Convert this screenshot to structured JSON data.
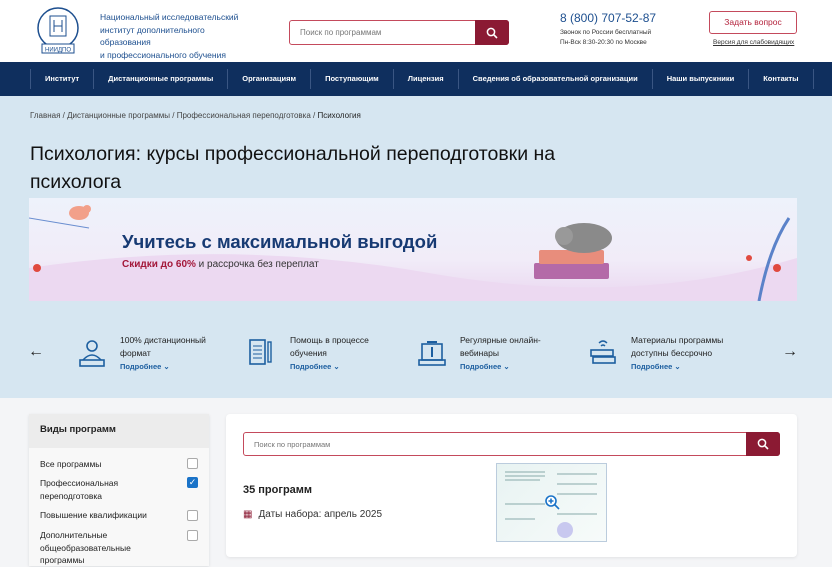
{
  "header": {
    "institute_name": [
      "Национальный исследовательский",
      "институт дополнительного образования",
      "и профессионального обучения"
    ],
    "logo_text": "НИИДПО",
    "search_placeholder": "Поиск по программам",
    "phone": "8 (800) 707-52-87",
    "phone_note": "Звонок по России бесплатный",
    "hours": "Пн-Вск 8:30-20:30 по Москве",
    "ask_button": "Задать вопрос",
    "accessibility_link": "Версия для слабовидящих"
  },
  "nav": [
    "Институт",
    "Дистанционные программы",
    "Организациям",
    "Поступающим",
    "Лицензия",
    "Сведения об образовательной организации",
    "Наши выпускники",
    "Контакты"
  ],
  "breadcrumb": [
    "Главная",
    "Дистанционные программы",
    "Профессиональная переподготовка",
    "Психология"
  ],
  "page_title": "Психология: курсы профессиональной переподготовки на психолога",
  "banner": {
    "headline": "Учитесь с максимальной выгодой",
    "discount": "Скидки до 60%",
    "rest": " и рассрочка без переплат"
  },
  "features": [
    {
      "text": "100% дистанционный формат",
      "more": "Подробнее ⌄"
    },
    {
      "text": "Помощь в процессе обучения",
      "more": "Подробнее ⌄"
    },
    {
      "text": "Регулярные онлайн-вебинары",
      "more": "Подробнее ⌄"
    },
    {
      "text": "Материалы программы доступны бессрочно",
      "more": "Подробнее ⌄"
    }
  ],
  "sidebar": {
    "title": "Виды программ",
    "options": [
      {
        "label": "Все программы",
        "checked": false
      },
      {
        "label": "Профессиональная переподготовка",
        "checked": true
      },
      {
        "label": "Повышение квалификации",
        "checked": false
      },
      {
        "label": "Дополнительные общеобразовательные программы",
        "checked": false
      }
    ]
  },
  "main": {
    "search_placeholder": "Поиск по программам",
    "count": "35 программ",
    "dates": "Даты набора: апрель 2025"
  },
  "colors": {
    "primary": "#0f2f5e",
    "accent": "#8b1a33",
    "hero_bg": "#d6e6f1"
  }
}
